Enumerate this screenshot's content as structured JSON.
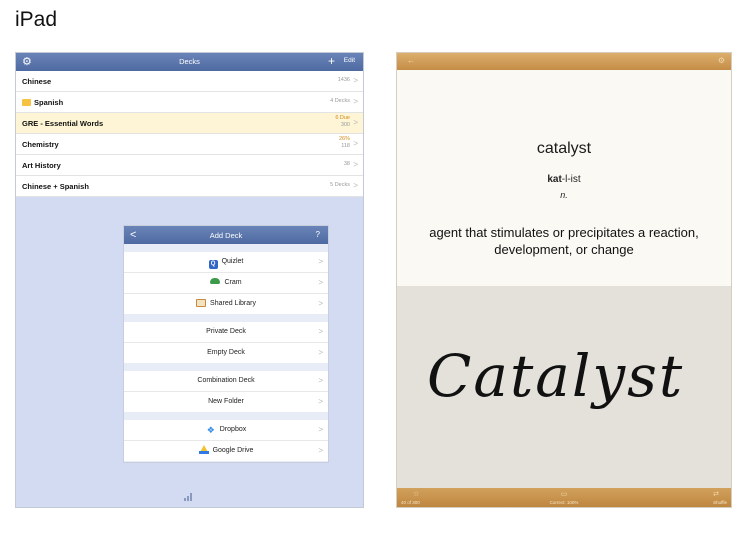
{
  "page_label": "iPad",
  "left": {
    "nav": {
      "gear": "⚙",
      "title": "Decks",
      "plus": "+",
      "edit": "Edit"
    },
    "decks": [
      {
        "name": "Chinese",
        "info": "1436"
      },
      {
        "name": "Spanish",
        "info": "4 Decks",
        "folder": true
      },
      {
        "name": "GRE - Essential Words",
        "info_line1": "6 Due",
        "info_line2": "300",
        "highlighted": true
      },
      {
        "name": "Chemistry",
        "info_line1": "26%",
        "info_line2": "118"
      },
      {
        "name": "Art History",
        "info": "38"
      },
      {
        "name": "Chinese + Spanish",
        "info": "5 Decks"
      }
    ],
    "chevron": ">",
    "add_deck": {
      "back": "<",
      "title": "Add Deck",
      "help": "?",
      "groups": [
        [
          {
            "label": "Quizlet",
            "icon": "quizlet-icon"
          },
          {
            "label": "Cram",
            "icon": "cram-icon"
          },
          {
            "label": "Shared Library",
            "icon": "library-icon"
          }
        ],
        [
          {
            "label": "Private Deck"
          },
          {
            "label": "Empty Deck"
          }
        ],
        [
          {
            "label": "Combination Deck"
          },
          {
            "label": "New Folder"
          }
        ],
        [
          {
            "label": "Dropbox",
            "icon": "dropbox-icon"
          },
          {
            "label": "Google Drive",
            "icon": "google-drive-icon"
          }
        ]
      ]
    }
  },
  "right": {
    "word": "catalyst",
    "pron_bold": "kat",
    "pron_rest": "-l-ist",
    "pos": "n.",
    "definition": "agent that stimulates or precipitates a reaction, development, or change",
    "handwriting": "Catalyst",
    "footer": {
      "left": "40 of 300",
      "middle": "Correct: 100%",
      "right": "Shuffle"
    }
  }
}
